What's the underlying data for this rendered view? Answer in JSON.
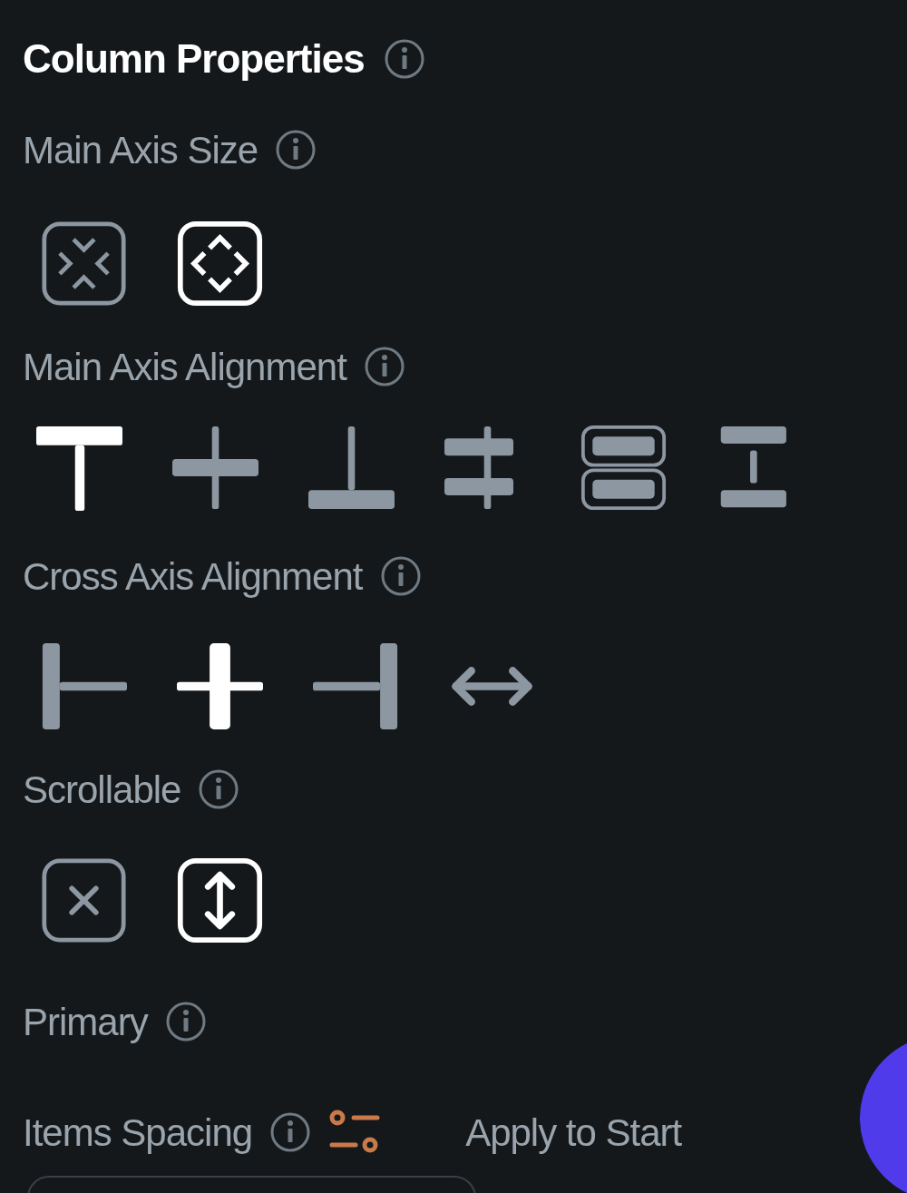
{
  "title": "Column Properties",
  "sections": [
    {
      "label": "Main Axis Size",
      "options": [
        {
          "kind": "shrink",
          "selected": false
        },
        {
          "kind": "expand",
          "selected": true
        }
      ]
    },
    {
      "label": "Main Axis Alignment",
      "options": [
        {
          "kind": "start",
          "selected": true
        },
        {
          "kind": "center",
          "selected": false
        },
        {
          "kind": "end",
          "selected": false
        },
        {
          "kind": "space-around",
          "selected": false
        },
        {
          "kind": "space-evenly",
          "selected": false
        },
        {
          "kind": "space-between",
          "selected": false
        }
      ]
    },
    {
      "label": "Cross Axis Alignment",
      "options": [
        {
          "kind": "cross-start",
          "selected": false
        },
        {
          "kind": "cross-center",
          "selected": true
        },
        {
          "kind": "cross-end",
          "selected": false
        },
        {
          "kind": "stretch",
          "selected": false
        }
      ]
    },
    {
      "label": "Scrollable",
      "options": [
        {
          "kind": "no-scroll",
          "selected": false
        },
        {
          "kind": "vertical-scroll",
          "selected": true
        }
      ]
    }
  ],
  "primary": {
    "label": "Primary"
  },
  "items_spacing": {
    "label": "Items Spacing",
    "apply_label": "Apply to Start"
  }
}
